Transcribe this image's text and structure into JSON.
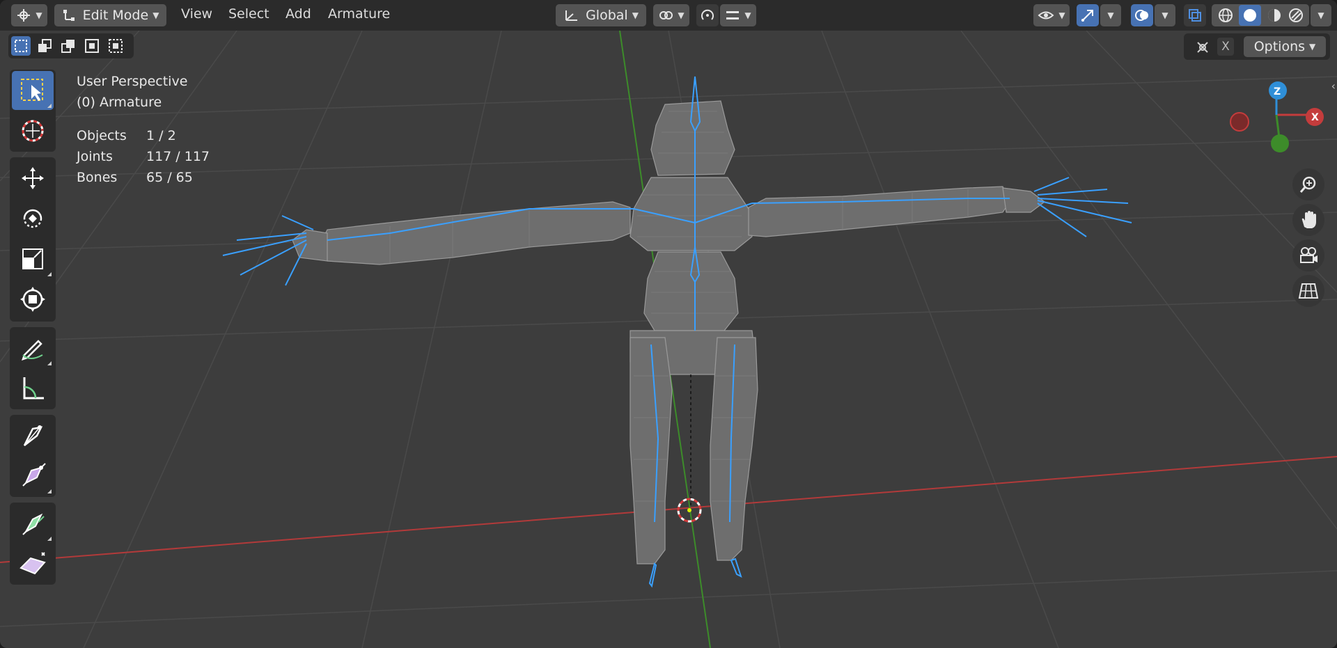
{
  "header": {
    "mode": "Edit Mode",
    "menus": [
      "View",
      "Select",
      "Add",
      "Armature"
    ],
    "transform_orientation": "Global",
    "options_label": "Options",
    "close_label": "X"
  },
  "overlay": {
    "view_name": "User Perspective",
    "object_name": "(0) Armature",
    "stats": [
      {
        "label": "Objects",
        "value": "1 / 2"
      },
      {
        "label": "Joints",
        "value": "117 / 117"
      },
      {
        "label": "Bones",
        "value": "65 / 65"
      }
    ]
  },
  "gizmo": {
    "axis_z": "Z",
    "axis_x": "X"
  },
  "colors": {
    "accent": "#4772b3",
    "bone": "#3aa0ff",
    "axis_x": "#c43c3c",
    "axis_y": "#3d8c2a",
    "axis_z": "#2f8fd8",
    "background": "#3d3d3d",
    "mesh": "#7a7a7a"
  },
  "tools": [
    "select-box-icon",
    "cursor-icon",
    "move-icon",
    "rotate-icon",
    "scale-icon",
    "transform-icon",
    "annotate-icon",
    "measure-icon",
    "extrude-icon",
    "bone-size-icon",
    "roll-icon",
    "shear-icon"
  ]
}
